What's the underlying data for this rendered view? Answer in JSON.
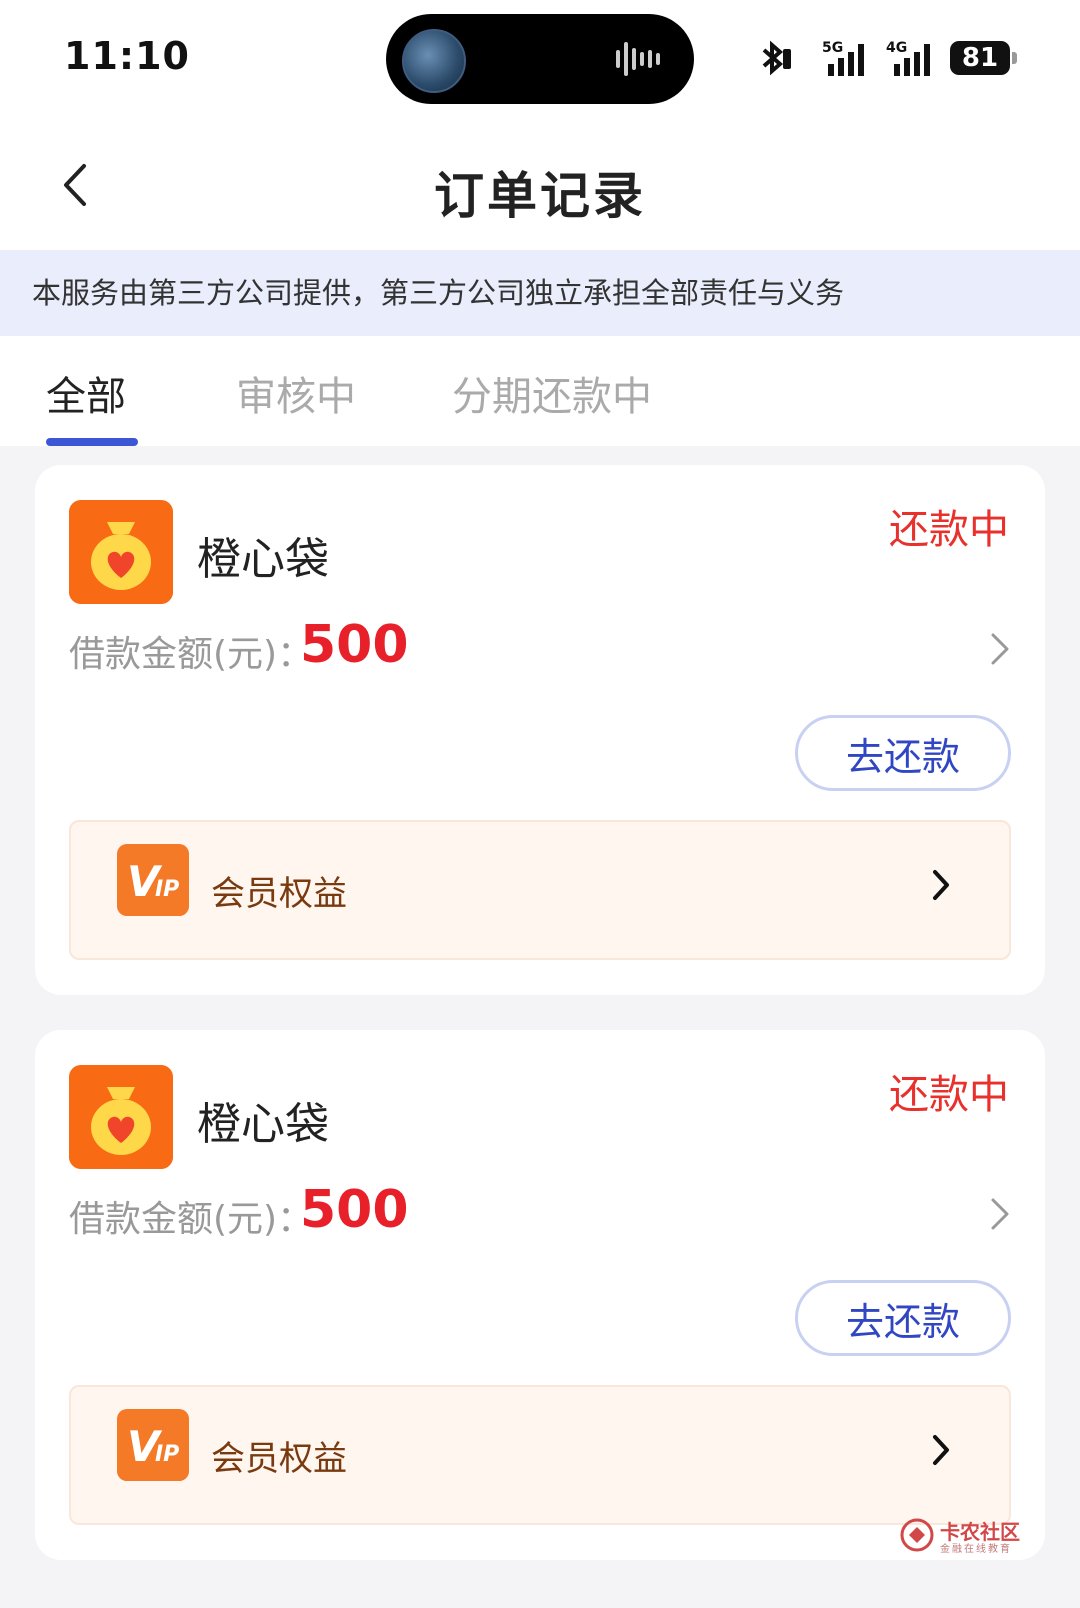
{
  "status_bar": {
    "time": "11:10",
    "battery": "81",
    "net1": "5G",
    "net2": "4G"
  },
  "header": {
    "title": "订单记录"
  },
  "notice": "本服务由第三方公司提供，第三方公司独立承担全部责任与义务",
  "tabs": [
    {
      "label": "全部",
      "active": true
    },
    {
      "label": "审核中",
      "active": false
    },
    {
      "label": "分期还款中",
      "active": false
    }
  ],
  "orders": [
    {
      "product": "橙心袋",
      "status": "还款中",
      "amount_label": "借款金额(元)：",
      "amount": "500",
      "repay_button": "去还款",
      "vip_label": "会员权益"
    },
    {
      "product": "橙心袋",
      "status": "还款中",
      "amount_label": "借款金额(元)：",
      "amount": "500",
      "repay_button": "去还款",
      "vip_label": "会员权益"
    }
  ],
  "watermark": {
    "text": "卡农社区",
    "subtext": "金融在线教育"
  },
  "colors": {
    "accent": "#3d56d6",
    "status_red": "#e8312c",
    "amount_red": "#e8202a",
    "brand_orange": "#f45a10"
  }
}
